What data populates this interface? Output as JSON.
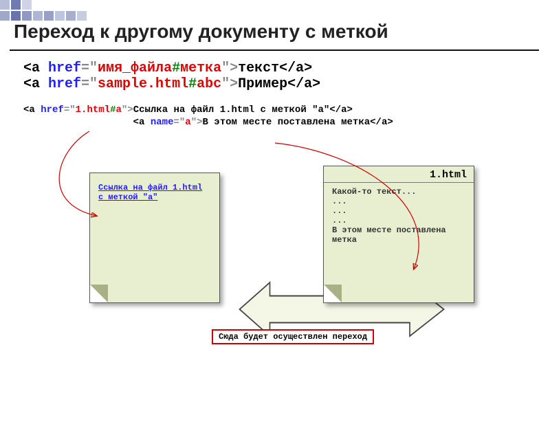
{
  "title": "Переход к другому документу с меткой",
  "code1": {
    "open": "<a ",
    "href_attr": "href",
    "eq": "=\"",
    "file": "имя_файла",
    "hash": "#",
    "anchor": "метка",
    "close_q": "\">",
    "text": "текст",
    "close": "</a>"
  },
  "code2": {
    "open": "<a ",
    "href_attr": "href",
    "eq": "=\"",
    "file": "sample.html",
    "hash": "#",
    "anchor": "abc",
    "close_q": "\">",
    "text": "Пример",
    "close": "</a>"
  },
  "code3": {
    "open": "<a ",
    "href_attr": "href",
    "eq": "=\"",
    "file": "1.html",
    "hash": "#",
    "anchor": "a",
    "close_q": "\">",
    "text": "Ссылка на файл 1.html с меткой \"a\"",
    "close": "</a>"
  },
  "code4": {
    "indent": "                   ",
    "open": "<a ",
    "name_attr": "name",
    "eq": "=\"",
    "anchor": "a",
    "close_q": "\">",
    "text": "В этом месте поставлена метка",
    "close": "</a>"
  },
  "doc_left_link": "Ссылка на файл 1.html с меткой \"a\"",
  "doc_right_title": "1.html",
  "doc_right_text": "Какой-то текст...\n...\n...\n...\nВ этом месте поставлена метка",
  "caption": "Сюда будет осуществлен переход"
}
